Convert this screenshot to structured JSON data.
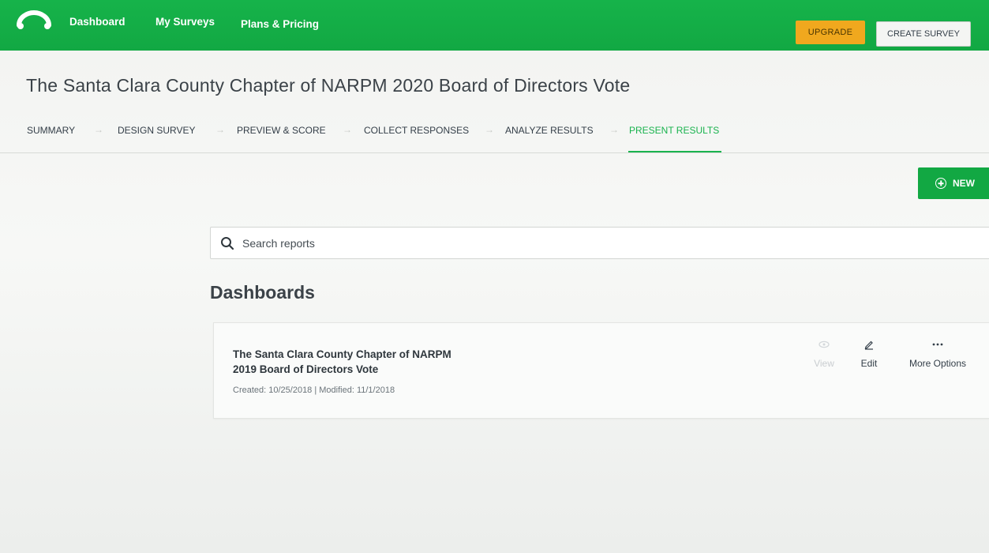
{
  "nav": {
    "logo_icon": "surveymonkey-logo-icon",
    "links": [
      "Dashboard",
      "My Surveys",
      "Plans & Pricing"
    ],
    "upgrade_label": "UPGRADE",
    "create_label": "CREATE SURVEY",
    "brand_color": "#12a843",
    "upgrade_color": "#f0a81e"
  },
  "survey": {
    "title": "The Santa Clara County Chapter of NARPM 2020 Board of Directors Vote"
  },
  "steps": [
    {
      "label": "SUMMARY",
      "active": false
    },
    {
      "label": "DESIGN SURVEY",
      "active": false
    },
    {
      "label": "PREVIEW & SCORE",
      "active": false
    },
    {
      "label": "COLLECT RESPONSES",
      "active": false
    },
    {
      "label": "ANALYZE RESULTS",
      "active": false
    },
    {
      "label": "PRESENT RESULTS",
      "active": true
    }
  ],
  "new_button": {
    "label": "NEW",
    "icon": "plus-circle-icon"
  },
  "search": {
    "placeholder": "Search reports",
    "value": "",
    "icon": "search-icon"
  },
  "section": {
    "heading": "Dashboards"
  },
  "dashboards": [
    {
      "title": "The Santa Clara County Chapter of NARPM 2019 Board of Directors Vote",
      "meta": "Created: 10/25/2018 | Modified: 11/1/2018",
      "actions": [
        {
          "label": "View",
          "icon": "eye-icon",
          "enabled": false
        },
        {
          "label": "Edit",
          "icon": "pencil-icon",
          "enabled": true
        },
        {
          "label": "More Options",
          "icon": "ellipsis-icon",
          "enabled": true
        }
      ]
    }
  ]
}
